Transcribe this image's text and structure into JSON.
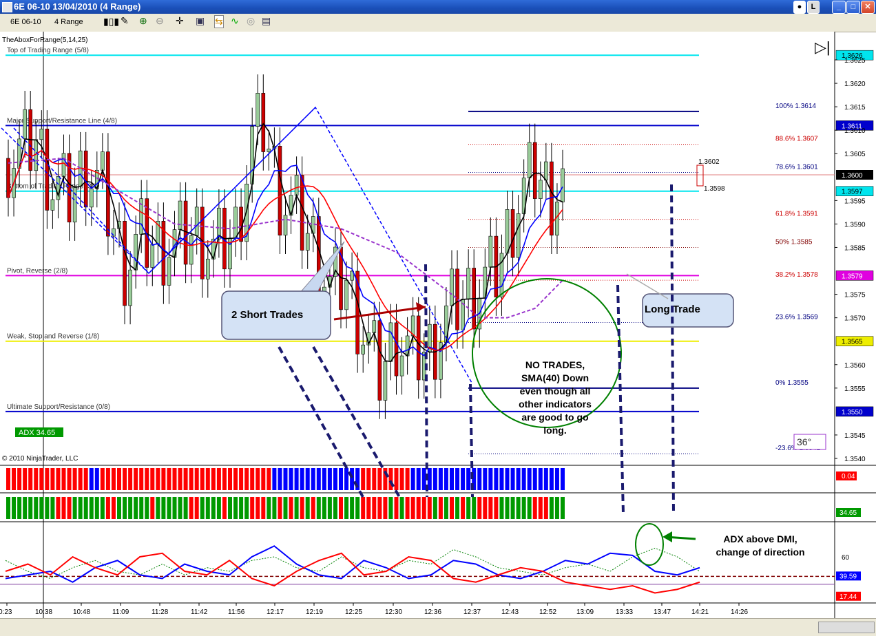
{
  "window": {
    "title": "6E 06-10  13/04/2010 (4 Range)"
  },
  "toolbar": {
    "instrument": "6E 06-10",
    "interval": "4 Range"
  },
  "chart": {
    "indicator_label": "TheAboxForRange(5,14,25)",
    "copyright": "© 2010 NinjaTrader, LLC",
    "adx_label": "ADX 34.65",
    "angle_label": "36°",
    "murrey_lines": [
      {
        "label": "Top of Trading Range (5/8)",
        "price": 1.3626,
        "color": "#00e5ee",
        "tag": "1.3626"
      },
      {
        "label": "Major Support/Resistance Line (4/8)",
        "price": 1.3611,
        "color": "#0000cc",
        "tag": "1.3611"
      },
      {
        "label": "Bottom of Trading Range (3/8)",
        "price": 1.3597,
        "color": "#00e5ee",
        "tag": "1.3597"
      },
      {
        "label": "Pivot, Reverse (2/8)",
        "price": 1.3579,
        "color": "#e000e0",
        "tag": "1.3579"
      },
      {
        "label": "Weak, Stop and Reverse (1/8)",
        "price": 1.3565,
        "color": "#eeee00",
        "tag": "1.3565"
      },
      {
        "label": "Ultimate Support/Resistance (0/8)",
        "price": 1.355,
        "color": "#0000cc",
        "tag": "1.3550"
      }
    ],
    "fib_levels": [
      {
        "label": "100%",
        "value": "1.3614",
        "price": 1.3614,
        "color": "#000080",
        "style": "solid"
      },
      {
        "label": "88.6%",
        "value": "1.3607",
        "price": 1.3607,
        "color": "#cc0000",
        "style": "dot"
      },
      {
        "label": "78.6%",
        "value": "1.3601",
        "price": 1.3601,
        "color": "#000080",
        "style": "dot"
      },
      {
        "label": "61.8%",
        "value": "1.3591",
        "price": 1.3591,
        "color": "#cc0000",
        "style": "dot"
      },
      {
        "label": "50%",
        "value": "1.3585",
        "price": 1.3585,
        "color": "#800000",
        "style": "dot"
      },
      {
        "label": "38.2%",
        "value": "1.3578",
        "price": 1.3578,
        "color": "#cc0000",
        "style": "dot"
      },
      {
        "label": "23.6%",
        "value": "1.3569",
        "price": 1.3569,
        "color": "#000080",
        "style": "dot"
      },
      {
        "label": "0%",
        "value": "1.3555",
        "price": 1.3555,
        "color": "#000080",
        "style": "solid"
      },
      {
        "label": "-23.6%",
        "value": "1.3541",
        "price": 1.3541,
        "color": "#000080",
        "style": "dot"
      }
    ],
    "price_ticks": [
      "1.3625",
      "1.3620",
      "1.3615",
      "1.3610",
      "1.3605",
      "1.3595",
      "1.3590",
      "1.3585",
      "1.3575",
      "1.3570",
      "1.3560",
      "1.3555",
      "1.3545",
      "1.3540"
    ],
    "price_tick_values": [
      1.3625,
      1.362,
      1.3615,
      1.361,
      1.3605,
      1.3595,
      1.359,
      1.3585,
      1.3575,
      1.357,
      1.356,
      1.3555,
      1.3545,
      1.354
    ],
    "current_price_tag": "1.3600",
    "hi_label": "1.3602",
    "lo_label": "1.3598",
    "ind1_value": "0.04",
    "ind2_value": "34.65",
    "adx_tick": "60",
    "adx_tags": [
      "39.59",
      "17.44"
    ],
    "time_labels": [
      "0:23",
      "10:38",
      "10:48",
      "11:09",
      "11:28",
      "11:42",
      "11:56",
      "12:17",
      "12:19",
      "12:25",
      "12:30",
      "12:36",
      "12:37",
      "12:43",
      "12:52",
      "13:09",
      "13:33",
      "13:47",
      "14:21",
      "14:26"
    ],
    "annotations": {
      "short_trades": "2 Short Trades",
      "long_trade": "Long Trade",
      "no_trades": [
        "NO TRADES,",
        "SMA(40) Down",
        "even though all",
        "other indicators",
        "are good to go",
        "long."
      ],
      "adx_note": [
        "ADX above DMI,",
        "change of direction"
      ]
    }
  },
  "chart_data": {
    "type": "candlestick",
    "instrument": "6E 06-10",
    "ylim": [
      1.3538,
      1.363
    ],
    "x_ticks": [
      "0:23",
      "10:38",
      "10:48",
      "11:09",
      "11:28",
      "11:42",
      "11:56",
      "12:17",
      "12:19",
      "12:25",
      "12:30",
      "12:36",
      "12:37",
      "12:43",
      "12:52",
      "13:09",
      "13:33",
      "13:47",
      "14:21",
      "14:26"
    ],
    "bars_count": 101,
    "close_path": [
      [
        0,
        1.3604
      ],
      [
        3,
        1.3606
      ],
      [
        5,
        1.3608
      ],
      [
        8,
        1.3598
      ],
      [
        11,
        1.3596
      ],
      [
        14,
        1.3602
      ],
      [
        17,
        1.3597
      ],
      [
        21,
        1.3581
      ],
      [
        24,
        1.3587
      ],
      [
        27,
        1.3585
      ],
      [
        30,
        1.3586
      ],
      [
        34,
        1.3588
      ],
      [
        37,
        1.3584
      ],
      [
        41,
        1.3588
      ],
      [
        44,
        1.3608
      ],
      [
        46,
        1.3611
      ],
      [
        49,
        1.3596
      ],
      [
        52,
        1.3592
      ],
      [
        55,
        1.3586
      ],
      [
        58,
        1.3576
      ],
      [
        61,
        1.3578
      ],
      [
        64,
        1.3567
      ],
      [
        67,
        1.3558
      ],
      [
        70,
        1.3566
      ],
      [
        73,
        1.3562
      ],
      [
        76,
        1.3563
      ],
      [
        80,
        1.3572
      ],
      [
        84,
        1.3576
      ],
      [
        88,
        1.358
      ],
      [
        92,
        1.3595
      ],
      [
        95,
        1.3601
      ],
      [
        98,
        1.3596
      ],
      [
        100,
        1.3599
      ]
    ],
    "series": [
      {
        "name": "SMA(40)",
        "color": "#9933cc",
        "values": [
          [
            0,
            1.3603
          ],
          [
            10,
            1.3604
          ],
          [
            20,
            1.3597
          ],
          [
            30,
            1.359
          ],
          [
            40,
            1.3589
          ],
          [
            50,
            1.3591
          ],
          [
            60,
            1.3589
          ],
          [
            70,
            1.3584
          ],
          [
            80,
            1.3575
          ],
          [
            85,
            1.357
          ],
          [
            90,
            1.357
          ],
          [
            95,
            1.3572
          ],
          [
            100,
            1.3578
          ]
        ]
      },
      {
        "name": "ADX",
        "color": "#008000",
        "values": [
          55,
          40,
          30,
          45,
          55,
          40,
          35,
          50,
          35,
          45,
          40,
          55,
          60,
          45,
          40,
          60,
          45,
          40,
          55,
          50,
          70,
          60,
          45,
          40,
          35,
          45,
          50,
          40,
          60,
          72,
          60,
          40
        ]
      },
      {
        "name": "DMI+",
        "color": "#0000ff",
        "values": [
          30,
          35,
          40,
          25,
          45,
          55,
          35,
          30,
          50,
          40,
          35,
          60,
          75,
          50,
          35,
          30,
          55,
          45,
          30,
          35,
          55,
          50,
          35,
          30,
          40,
          55,
          50,
          65,
          62,
          40,
          35,
          45
        ]
      },
      {
        "name": "DMI-",
        "color": "#ff0000",
        "values": [
          40,
          50,
          35,
          60,
          45,
          35,
          60,
          65,
          40,
          35,
          55,
          30,
          20,
          40,
          55,
          65,
          35,
          40,
          60,
          55,
          30,
          25,
          35,
          45,
          40,
          25,
          20,
          15,
          20,
          10,
          15,
          25
        ]
      }
    ]
  }
}
